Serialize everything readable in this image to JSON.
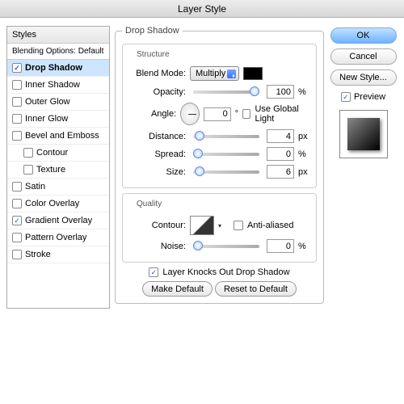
{
  "window": {
    "title": "Layer Style"
  },
  "left": {
    "header": "Styles",
    "blending": "Blending Options: Default",
    "items": [
      {
        "label": "Drop Shadow",
        "checked": true,
        "selected": true
      },
      {
        "label": "Inner Shadow",
        "checked": false
      },
      {
        "label": "Outer Glow",
        "checked": false
      },
      {
        "label": "Inner Glow",
        "checked": false
      },
      {
        "label": "Bevel and Emboss",
        "checked": false
      },
      {
        "label": "Contour",
        "checked": false,
        "indent": true
      },
      {
        "label": "Texture",
        "checked": false,
        "indent": true
      },
      {
        "label": "Satin",
        "checked": false
      },
      {
        "label": "Color Overlay",
        "checked": false
      },
      {
        "label": "Gradient Overlay",
        "checked": true
      },
      {
        "label": "Pattern Overlay",
        "checked": false
      },
      {
        "label": "Stroke",
        "checked": false
      }
    ]
  },
  "mid": {
    "group": "Drop Shadow",
    "structure": {
      "title": "Structure",
      "blendmode_label": "Blend Mode:",
      "blendmode_value": "Multiply",
      "shadow_color": "#000000",
      "opacity_label": "Opacity:",
      "opacity_value": "100",
      "angle_label": "Angle:",
      "angle_value": "0",
      "global_light": "Use Global Light",
      "global_light_checked": false,
      "distance_label": "Distance:",
      "distance_value": "4",
      "spread_label": "Spread:",
      "spread_value": "0",
      "size_label": "Size:",
      "size_value": "6"
    },
    "quality": {
      "title": "Quality",
      "contour_label": "Contour:",
      "antialias": "Anti-aliased",
      "antialias_checked": false,
      "noise_label": "Noise:",
      "noise_value": "0"
    },
    "knockout": "Layer Knocks Out Drop Shadow",
    "knockout_checked": true,
    "make_default": "Make Default",
    "reset_default": "Reset to Default"
  },
  "right": {
    "ok": "OK",
    "cancel": "Cancel",
    "new_style": "New Style...",
    "preview": "Preview",
    "preview_checked": true
  },
  "units": {
    "percent": "%",
    "px": "px",
    "degree": "°"
  }
}
